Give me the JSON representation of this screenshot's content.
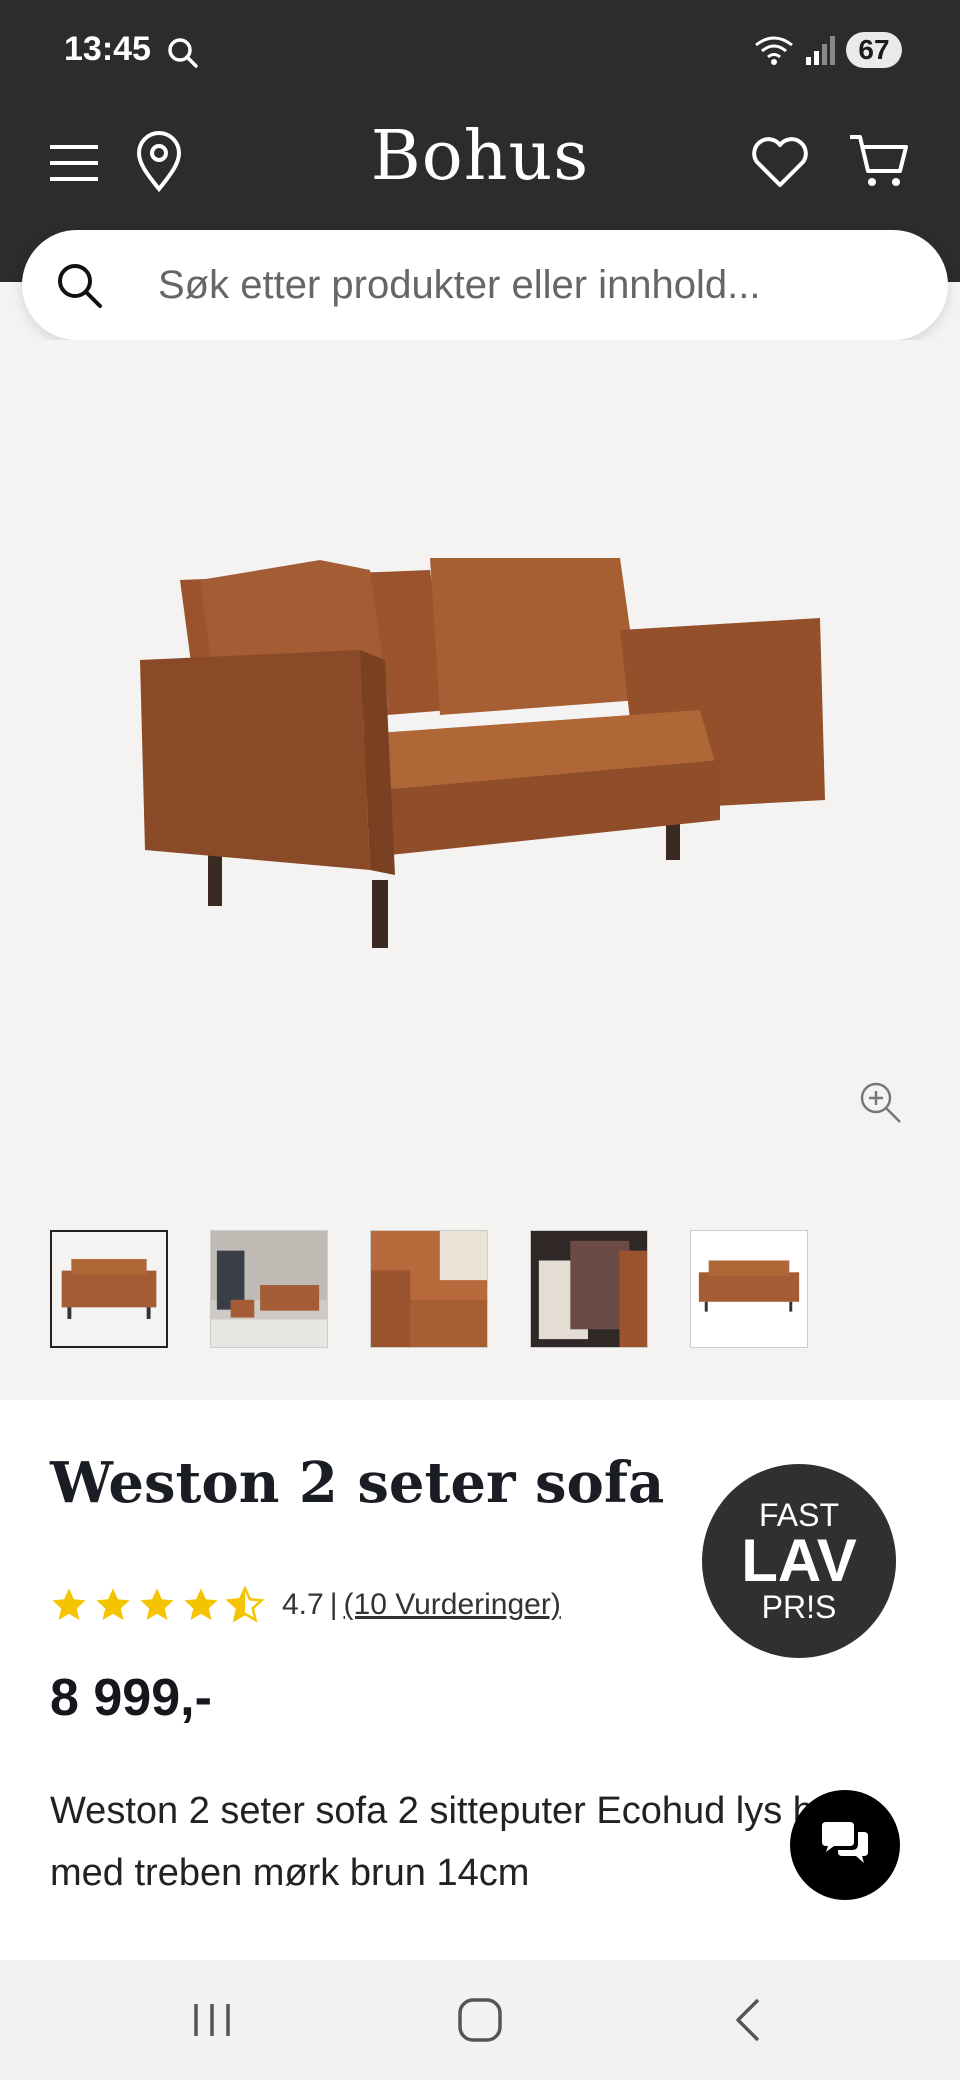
{
  "status_bar": {
    "time": "13:45",
    "battery": "67"
  },
  "header": {
    "logo": "Bohus"
  },
  "search": {
    "placeholder": "Søk etter produkter eller innhold..."
  },
  "gallery": {
    "thumbnail_count": 5,
    "active_thumbnail": 1
  },
  "product": {
    "title": "Weston 2 seter sofa",
    "rating_value": "4.7",
    "rating_separator": "|",
    "reviews_label": "(10 Vurderinger)",
    "stars": 4.5,
    "price": "8 999,-",
    "description": "Weston 2 seter sofa 2 sitteputer Ecohud lys brun med treben mørk brun 14cm"
  },
  "badge": {
    "line1": "FAST",
    "line2": "LAV",
    "line3": "PR!S"
  },
  "colors": {
    "header_bg": "#2c2c2e",
    "star": "#f5c400",
    "sofa": "#a65e33"
  },
  "icons": [
    "search-icon",
    "menu-icon",
    "location-pin-icon",
    "heart-icon",
    "cart-icon",
    "zoom-in-icon",
    "chat-icon",
    "star-icon",
    "recent-apps-icon",
    "home-icon",
    "back-icon"
  ]
}
